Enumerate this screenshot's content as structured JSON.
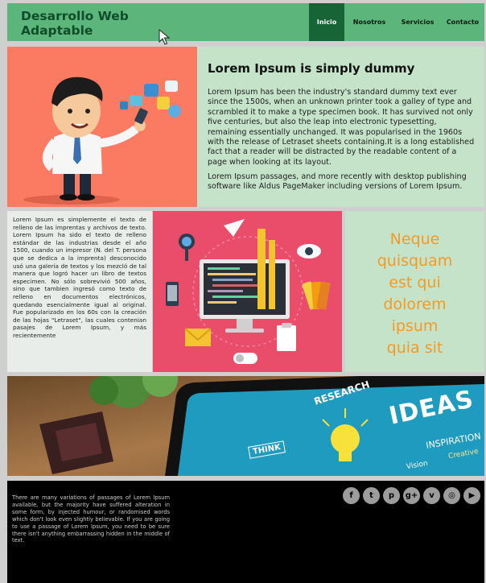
{
  "header": {
    "brand_line1": "Desarrollo Web",
    "brand_line2": "Adaptable",
    "nav": [
      {
        "label": "Inicio",
        "active": true
      },
      {
        "label": "Nosotros",
        "active": false
      },
      {
        "label": "Servicios",
        "active": false
      },
      {
        "label": "Contacto",
        "active": false
      }
    ]
  },
  "hero": {
    "title": "Lorem Ipsum is simply dummy",
    "paragraph1": "Lorem Ipsum has been the industry's standard dummy text ever since the 1500s, when an unknown printer took a galley of type and scrambled it to make a type specimen book. It has survived not only five centuries, but also the leap into electronic typesetting, remaining essentially unchanged. It was popularised in the 1960s with the release of Letraset sheets containing.It is a long established fact that a reader will be distracted by the readable content of a page when looking at its layout.",
    "paragraph2": "Lorem Ipsum passages, and more recently with desktop publishing software like Aldus PageMaker including versions of Lorem Ipsum."
  },
  "middle": {
    "left_text": "Lorem Ipsum es simplemente el texto de relleno de las imprentas y archivos de texto. Lorem Ipsum ha sido el texto de relleno estándar de las industrias desde el año 1500, cuando un impresor (N. del T. persona que se dedica a la imprenta) desconocido usó una galería de textos y los mezcló de tal manera que logró hacer un libro de textos especimen. No sólo sobrevivió 500 años, sino que tambien ingresó como texto de relleno en documentos electrónicos, quedando esencialmente igual al original. Fue popularizado en los 60s con la creación de las hojas \"Letraset\", las cuales contenian pasajes de Lorem Ipsum, y más recientemente",
    "quote_lines": [
      "Neque",
      "quisquam",
      "est qui",
      "dolorem",
      "ipsum",
      "quia sit"
    ]
  },
  "banner": {
    "words": [
      "RESEARCH",
      "IDEAS",
      "THINK",
      "INSPIRATION",
      "Creative",
      "Vision"
    ]
  },
  "footer": {
    "text": "There are many variations of passages of Lorem Ipsum available, but the majority have suffered alteration in some form, by injected humour, or randomised words which don't look even slightly believable. If you are going to use a passage of Lorem Ipsum, you need to be sure there isn't anything embarrassing hidden in the middle of text.",
    "social_icons": [
      {
        "name": "facebook-icon",
        "glyph": "f"
      },
      {
        "name": "twitter-icon",
        "glyph": "t"
      },
      {
        "name": "pinterest-icon",
        "glyph": "p"
      },
      {
        "name": "google-plus-icon",
        "glyph": "g+"
      },
      {
        "name": "vimeo-icon",
        "glyph": "v"
      },
      {
        "name": "instagram-icon",
        "glyph": "◎"
      },
      {
        "name": "youtube-icon",
        "glyph": "▶"
      }
    ]
  },
  "colors": {
    "header_bg": "#5cb57a",
    "nav_active": "#176437",
    "hero_image_bg": "#fa7a62",
    "panel_green": "#c4e3c9",
    "workspace_bg": "#ea4d6a",
    "quote_orange": "#f49a24",
    "footer_bg": "#000000"
  }
}
